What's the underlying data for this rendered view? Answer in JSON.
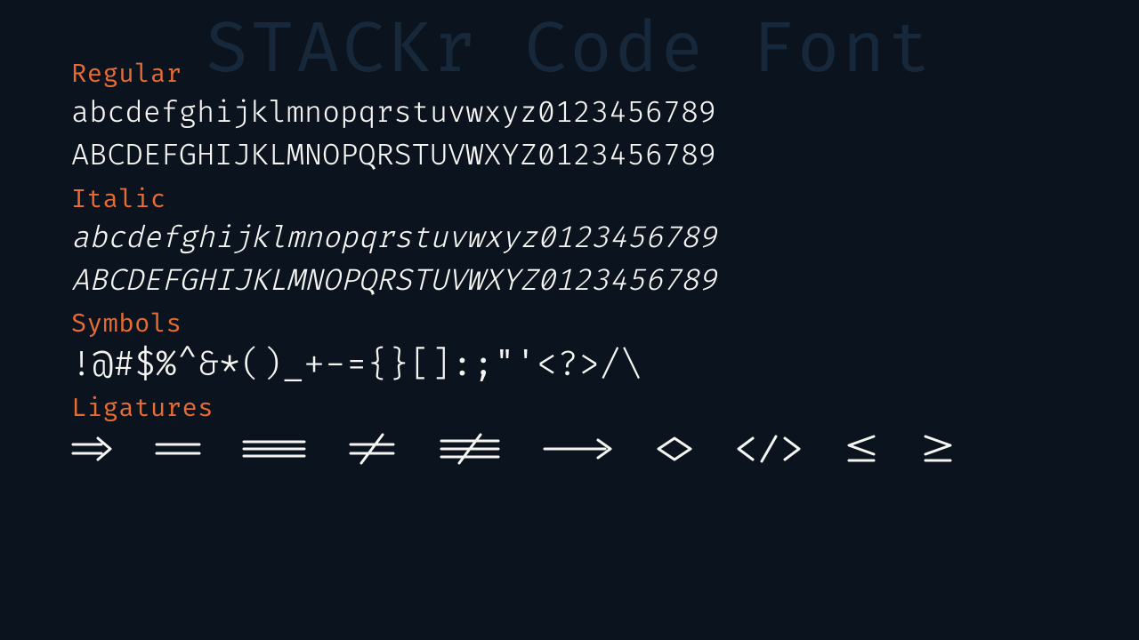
{
  "background_title": "STACKr Code Font",
  "sections": {
    "regular": {
      "label": "Regular",
      "line1": "abcdefghijklmnopqrstuvwxyz0123456789",
      "line2": "ABCDEFGHIJKLMNOPQRSTUVWXYZ0123456789"
    },
    "italic": {
      "label": "Italic",
      "line1": "abcdefghijklmnopqrstuvwxyz0123456789",
      "line2": "ABCDEFGHIJKLMNOPQRSTUVWXYZ0123456789"
    },
    "symbols": {
      "label": "Symbols",
      "line1": "!@#$%^&*()_+-={}[]:;\"'<?>/\\"
    },
    "ligatures": {
      "label": "Ligatures",
      "glyphs": [
        "fat-arrow-right",
        "double-equals",
        "triple-equals",
        "not-equals",
        "not-triple-equals",
        "long-arrow-right",
        "diamond",
        "self-closing-tag",
        "less-than-or-equal",
        "greater-than-or-equal"
      ]
    }
  },
  "colors": {
    "background": "#0b141e",
    "foreground": "#f5f5f2",
    "accent": "#e86b33",
    "ghost": "#16283a"
  }
}
